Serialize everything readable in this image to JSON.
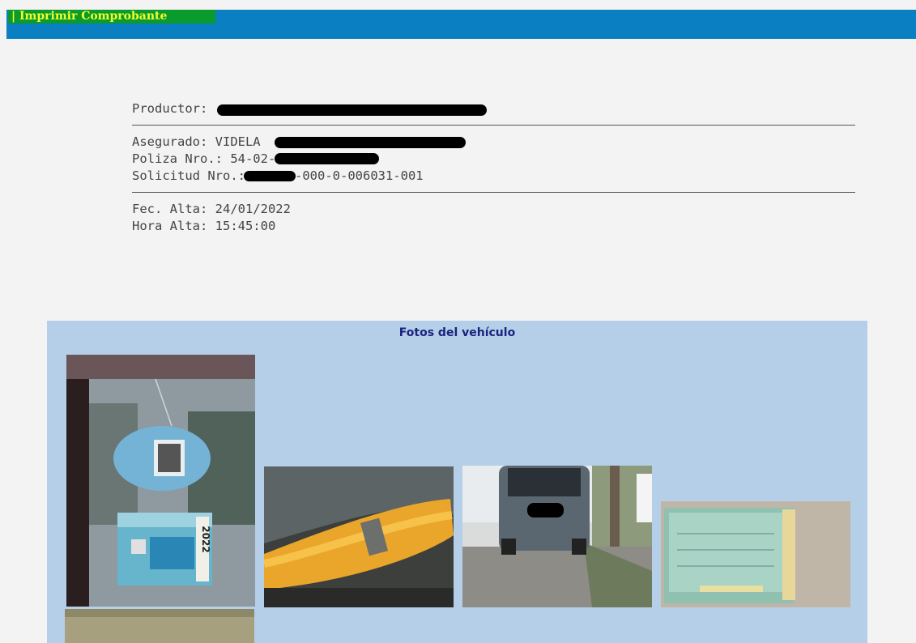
{
  "header": {
    "tab_label": "| Imprimir Comprobante"
  },
  "receipt": {
    "productor_label": "Productor:",
    "asegurado": "Asegurado: VIDELA",
    "poliza": "Poliza Nro.: 54-02-",
    "solicitud_label": "Solicitud Nro.:",
    "solicitud_suffix": "-000-0-006031-001",
    "fec_alta": "Fec. Alta: 24/01/2022",
    "hora_alta": "Hora Alta: 15:45:00"
  },
  "photos": {
    "title": "Fotos del vehículo",
    "plate_sticker_year": "2022"
  },
  "colors": {
    "topbar": "#0a7fc1",
    "tab_bg": "#0b9a2c",
    "tab_text": "#f2ff2e",
    "photos_bg": "#b5cfe8",
    "photos_title": "#1a237e"
  }
}
